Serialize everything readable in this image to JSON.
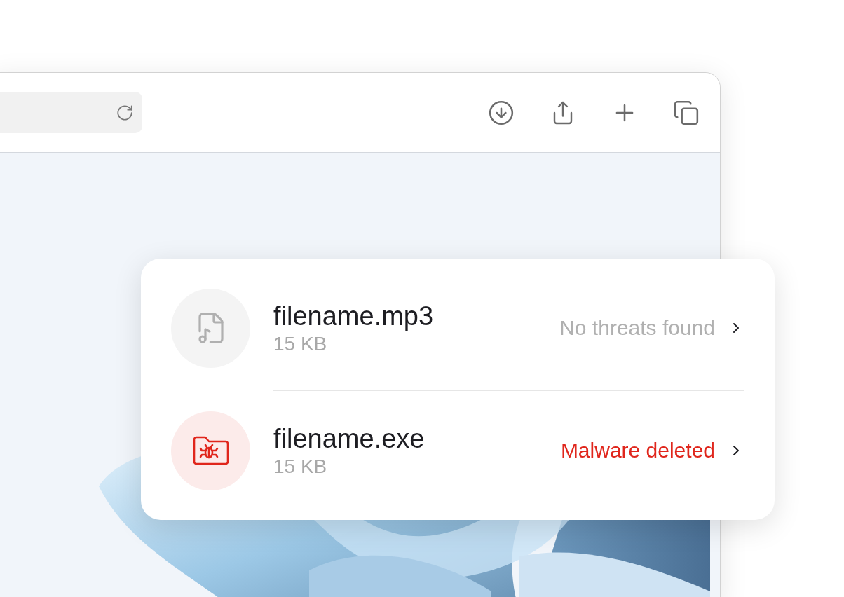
{
  "downloads": [
    {
      "name": "filename.mp3",
      "size": "15 KB",
      "status": "No threats found",
      "kind": "clean"
    },
    {
      "name": "filename.exe",
      "size": "15 KB",
      "status": "Malware deleted",
      "kind": "malware"
    }
  ]
}
